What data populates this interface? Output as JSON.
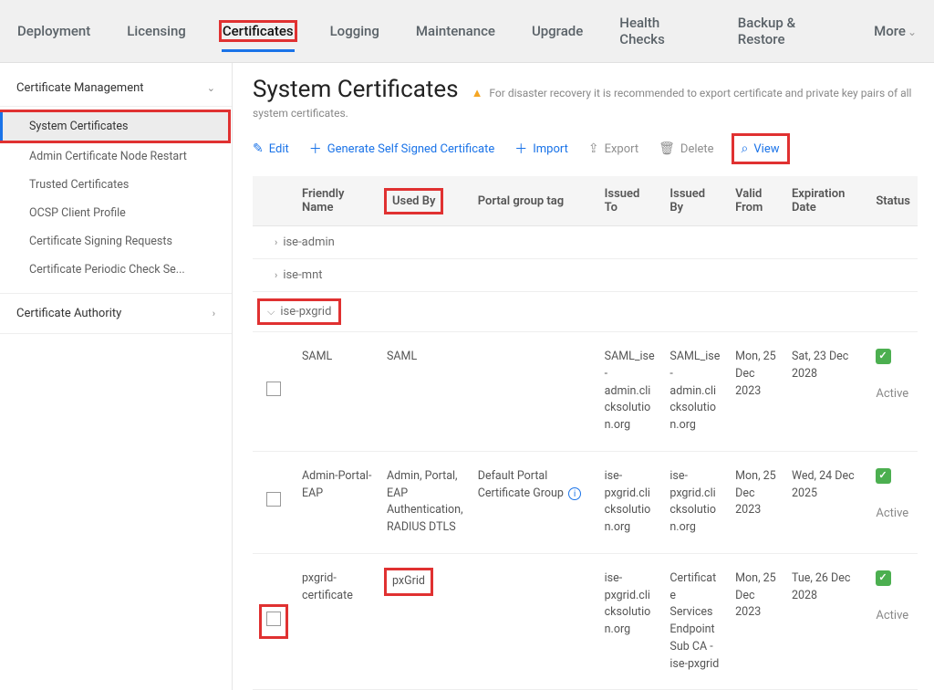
{
  "tabs": {
    "deployment": "Deployment",
    "licensing": "Licensing",
    "certificates": "Certificates",
    "logging": "Logging",
    "maintenance": "Maintenance",
    "upgrade": "Upgrade",
    "health_checks": "Health Checks",
    "backup_restore": "Backup & Restore",
    "more": "More"
  },
  "sidebar": {
    "section": "Certificate Management",
    "items": [
      "System Certificates",
      "Admin Certificate Node Restart",
      "Trusted Certificates",
      "OCSP Client Profile",
      "Certificate Signing Requests",
      "Certificate Periodic Check Se..."
    ],
    "authority": "Certificate Authority"
  },
  "page": {
    "title": "System Certificates",
    "warning1": "For disaster recovery it is recommended to export certificate and private key pairs of all",
    "warning2": "system certificates."
  },
  "toolbar": {
    "edit": "Edit",
    "generate": "Generate Self Signed Certificate",
    "import": "Import",
    "export": "Export",
    "delete": "Delete",
    "view": "View"
  },
  "table": {
    "headers": {
      "friendly_name": "Friendly Name",
      "used_by": "Used By",
      "portal_group": "Portal group tag",
      "issued_to": "Issued To",
      "issued_by": "Issued By",
      "valid_from": "Valid From",
      "expiration": "Expiration Date",
      "status": "Status"
    },
    "groups": {
      "ise_admin": "ise-admin",
      "ise_mnt": "ise-mnt",
      "ise_pxgrid": "ise-pxgrid"
    },
    "rows": [
      {
        "friendly_name": "SAML",
        "used_by": "SAML",
        "portal_group": "",
        "issued_to": "SAML_ise-admin.clicksolution.org",
        "issued_by": "SAML_ise-admin.clicksolution.org",
        "valid_from": "Mon, 25 Dec 2023",
        "expiration": "Sat, 23 Dec 2028",
        "status": "Active"
      },
      {
        "friendly_name": "Admin-Portal-EAP",
        "used_by": "Admin, Portal, EAP Authentication, RADIUS DTLS",
        "portal_group": "Default Portal Certificate Group",
        "issued_to": "ise-pxgrid.clicksolution.org",
        "issued_by": "ise-pxgrid.clicksolution.org",
        "valid_from": "Mon, 25 Dec 2023",
        "expiration": "Wed, 24 Dec 2025",
        "status": "Active"
      },
      {
        "friendly_name": "pxgrid-certificate",
        "used_by": "pxGrid",
        "portal_group": "",
        "issued_to": "ise-pxgrid.clicksolution.org",
        "issued_by": "Certificate Services Endpoint Sub CA - ise-pxgrid",
        "valid_from": "Mon, 25 Dec 2023",
        "expiration": "Tue, 26 Dec 2028",
        "status": "Active"
      }
    ]
  }
}
